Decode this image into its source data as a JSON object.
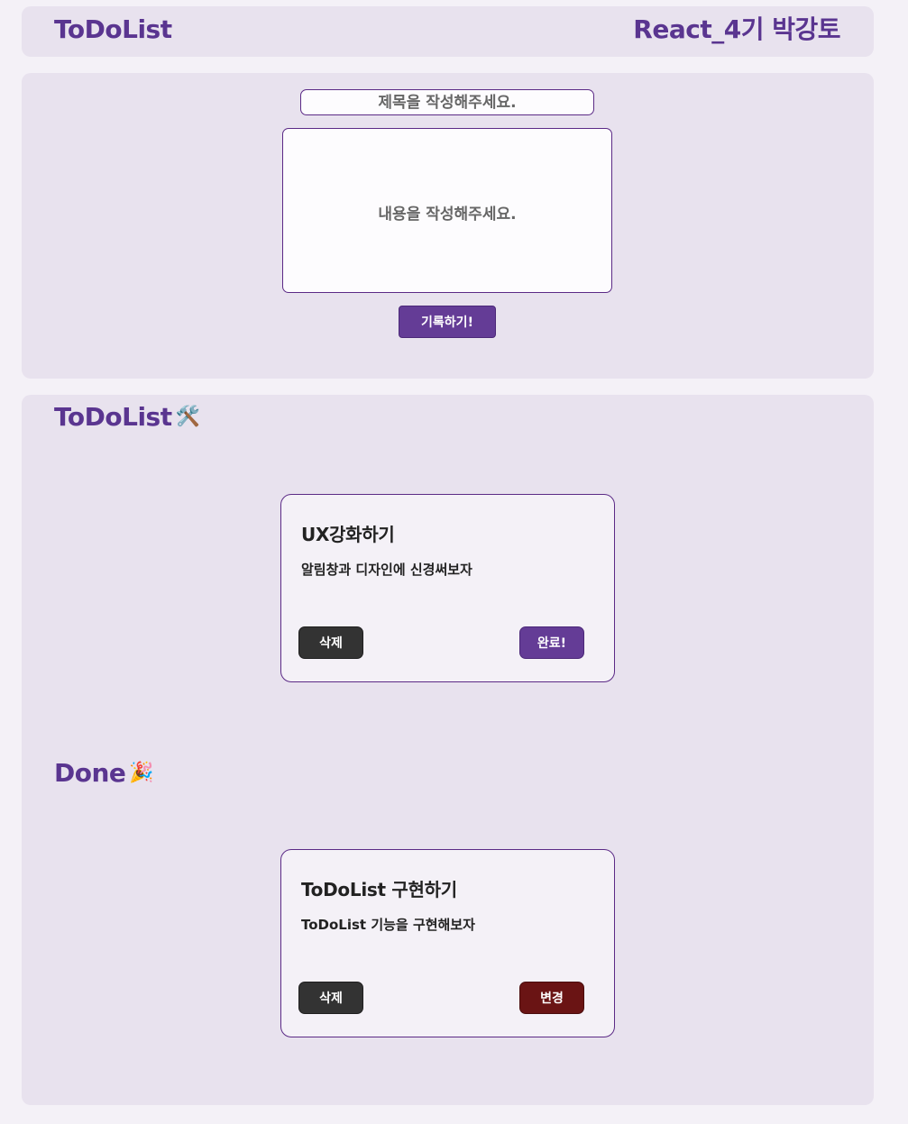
{
  "header": {
    "title": "ToDoList",
    "author": "React_4기 박강토"
  },
  "form": {
    "title_placeholder": "제목을 작성해주세요.",
    "content_placeholder": "내용을 작성해주세요.",
    "submit_label": "기록하기!"
  },
  "todo_section": {
    "title": "ToDoList",
    "emoji": "🛠️",
    "cards": [
      {
        "title": "UX강화하기",
        "body": "알림창과 디자인에 신경써보자",
        "delete_label": "삭제",
        "action_label": "완료!"
      }
    ]
  },
  "done_section": {
    "title": "Done",
    "emoji": "🎉",
    "cards": [
      {
        "title": "ToDoList 구현하기",
        "body": "ToDoList 기능을 구현해보자",
        "delete_label": "삭제",
        "action_label": "변경"
      }
    ]
  },
  "colors": {
    "accent": "#643c96",
    "delete": "#333333",
    "change": "#6a1414",
    "panel": "#e8e2ee"
  }
}
